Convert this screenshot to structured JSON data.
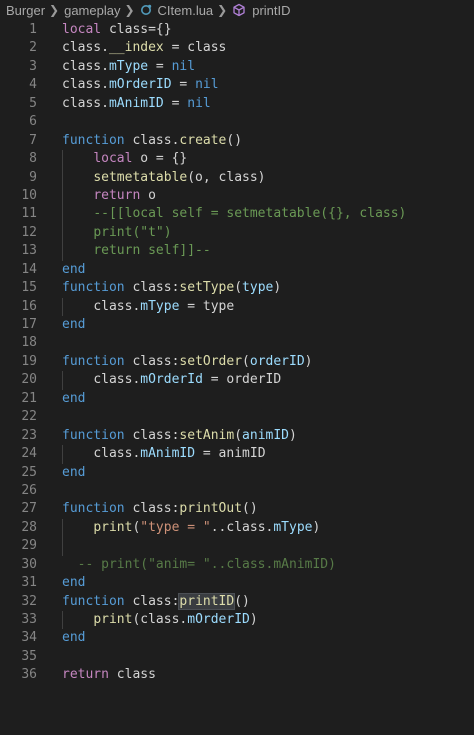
{
  "breadcrumb": {
    "items": [
      "Burger",
      "gameplay",
      "CItem.lua",
      "printID"
    ]
  },
  "code": {
    "lines": [
      {
        "n": "1",
        "tokens": [
          [
            "kw",
            "local"
          ],
          [
            "var",
            " class={}"
          ]
        ]
      },
      {
        "n": "2",
        "tokens": [
          [
            "var",
            "class."
          ],
          [
            "fn",
            "__index"
          ],
          [
            "var",
            " = class"
          ]
        ]
      },
      {
        "n": "3",
        "tokens": [
          [
            "var",
            "class."
          ],
          [
            "prop",
            "mType"
          ],
          [
            "var",
            " = "
          ],
          [
            "kwb",
            "nil"
          ]
        ]
      },
      {
        "n": "4",
        "tokens": [
          [
            "var",
            "class."
          ],
          [
            "prop",
            "mOrderID"
          ],
          [
            "var",
            " = "
          ],
          [
            "kwb",
            "nil"
          ]
        ]
      },
      {
        "n": "5",
        "tokens": [
          [
            "var",
            "class."
          ],
          [
            "prop",
            "mAnimID"
          ],
          [
            "var",
            " = "
          ],
          [
            "kwb",
            "nil"
          ]
        ]
      },
      {
        "n": "6",
        "tokens": []
      },
      {
        "n": "7",
        "tokens": [
          [
            "fnkw",
            "function"
          ],
          [
            "var",
            " class."
          ],
          [
            "fn",
            "create"
          ],
          [
            "var",
            "()"
          ]
        ]
      },
      {
        "n": "8",
        "indent": 1,
        "tokens": [
          [
            "kw",
            "local"
          ],
          [
            "var",
            " o = {}"
          ]
        ]
      },
      {
        "n": "9",
        "indent": 1,
        "tokens": [
          [
            "fn",
            "setmetatable"
          ],
          [
            "var",
            "(o, class)"
          ]
        ]
      },
      {
        "n": "10",
        "indent": 1,
        "tokens": [
          [
            "kw",
            "return"
          ],
          [
            "var",
            " o"
          ]
        ]
      },
      {
        "n": "11",
        "indent": 1,
        "tokens": [
          [
            "cmt",
            "--[[local self = setmetatable({}, class)"
          ]
        ]
      },
      {
        "n": "12",
        "indent": 1,
        "tokens": [
          [
            "cmt",
            "print(\"t\")"
          ]
        ]
      },
      {
        "n": "13",
        "indent": 1,
        "tokens": [
          [
            "cmt",
            "return self]]--"
          ]
        ]
      },
      {
        "n": "14",
        "tokens": [
          [
            "fnkw",
            "end"
          ]
        ]
      },
      {
        "n": "15",
        "tokens": [
          [
            "fnkw",
            "function"
          ],
          [
            "var",
            " class:"
          ],
          [
            "fn",
            "setType"
          ],
          [
            "var",
            "("
          ],
          [
            "param",
            "type"
          ],
          [
            "var",
            ")"
          ]
        ]
      },
      {
        "n": "16",
        "indent": 1,
        "tokens": [
          [
            "var",
            "class."
          ],
          [
            "prop",
            "mType"
          ],
          [
            "var",
            " = type"
          ]
        ]
      },
      {
        "n": "17",
        "tokens": [
          [
            "fnkw",
            "end"
          ]
        ]
      },
      {
        "n": "18",
        "tokens": []
      },
      {
        "n": "19",
        "tokens": [
          [
            "fnkw",
            "function"
          ],
          [
            "var",
            " class:"
          ],
          [
            "fn",
            "setOrder"
          ],
          [
            "var",
            "("
          ],
          [
            "param",
            "orderID"
          ],
          [
            "var",
            ")"
          ]
        ]
      },
      {
        "n": "20",
        "indent": 1,
        "tokens": [
          [
            "var",
            "class."
          ],
          [
            "prop",
            "mOrderId"
          ],
          [
            "var",
            " = orderID"
          ]
        ]
      },
      {
        "n": "21",
        "tokens": [
          [
            "fnkw",
            "end"
          ]
        ]
      },
      {
        "n": "22",
        "tokens": []
      },
      {
        "n": "23",
        "tokens": [
          [
            "fnkw",
            "function"
          ],
          [
            "var",
            " class:"
          ],
          [
            "fn",
            "setAnim"
          ],
          [
            "var",
            "("
          ],
          [
            "param",
            "animID"
          ],
          [
            "var",
            ")"
          ]
        ]
      },
      {
        "n": "24",
        "indent": 1,
        "tokens": [
          [
            "var",
            "class."
          ],
          [
            "prop",
            "mAnimID"
          ],
          [
            "var",
            " = animID"
          ]
        ]
      },
      {
        "n": "25",
        "tokens": [
          [
            "fnkw",
            "end"
          ]
        ]
      },
      {
        "n": "26",
        "tokens": []
      },
      {
        "n": "27",
        "tokens": [
          [
            "fnkw",
            "function"
          ],
          [
            "var",
            " class:"
          ],
          [
            "fn",
            "printOut"
          ],
          [
            "var",
            "()"
          ]
        ]
      },
      {
        "n": "28",
        "indent": 1,
        "tokens": [
          [
            "fn",
            "print"
          ],
          [
            "var",
            "("
          ],
          [
            "str",
            "\"type = \""
          ],
          [
            "var",
            ".."
          ],
          [
            "var",
            "class."
          ],
          [
            "prop",
            "mType"
          ],
          [
            "var",
            ")"
          ]
        ]
      },
      {
        "n": "29",
        "indent": 1,
        "tokens": []
      },
      {
        "n": "30",
        "tokens": [
          [
            "cmt-dim",
            "  -- print(\"anim= \"..class.mAnimID)"
          ]
        ]
      },
      {
        "n": "31",
        "tokens": [
          [
            "fnkw",
            "end"
          ]
        ]
      },
      {
        "n": "32",
        "tokens": [
          [
            "fnkw",
            "function"
          ],
          [
            "var",
            " class:"
          ],
          [
            "fn hl",
            "printID"
          ],
          [
            "var",
            "()"
          ]
        ]
      },
      {
        "n": "33",
        "indent": 1,
        "tokens": [
          [
            "fn",
            "print"
          ],
          [
            "var",
            "(class."
          ],
          [
            "prop",
            "mOrderID"
          ],
          [
            "var",
            ")"
          ]
        ]
      },
      {
        "n": "34",
        "tokens": [
          [
            "fnkw",
            "end"
          ]
        ]
      },
      {
        "n": "35",
        "tokens": []
      },
      {
        "n": "36",
        "tokens": [
          [
            "kw",
            "return"
          ],
          [
            "var",
            " class"
          ]
        ]
      }
    ]
  },
  "icons": {
    "separator": "chevron-right-icon",
    "file": "lua-file-icon",
    "symbol": "method-cube-icon"
  },
  "colors": {
    "background": "#1e1e1e",
    "line_number": "#858585",
    "keyword": "#c586c0",
    "function": "#dcdcaa",
    "property": "#9cdcfe",
    "string": "#ce9178",
    "comment": "#6a9955",
    "constant": "#569cd6",
    "lua_icon": "#519aba",
    "method_icon": "#b180d7"
  }
}
